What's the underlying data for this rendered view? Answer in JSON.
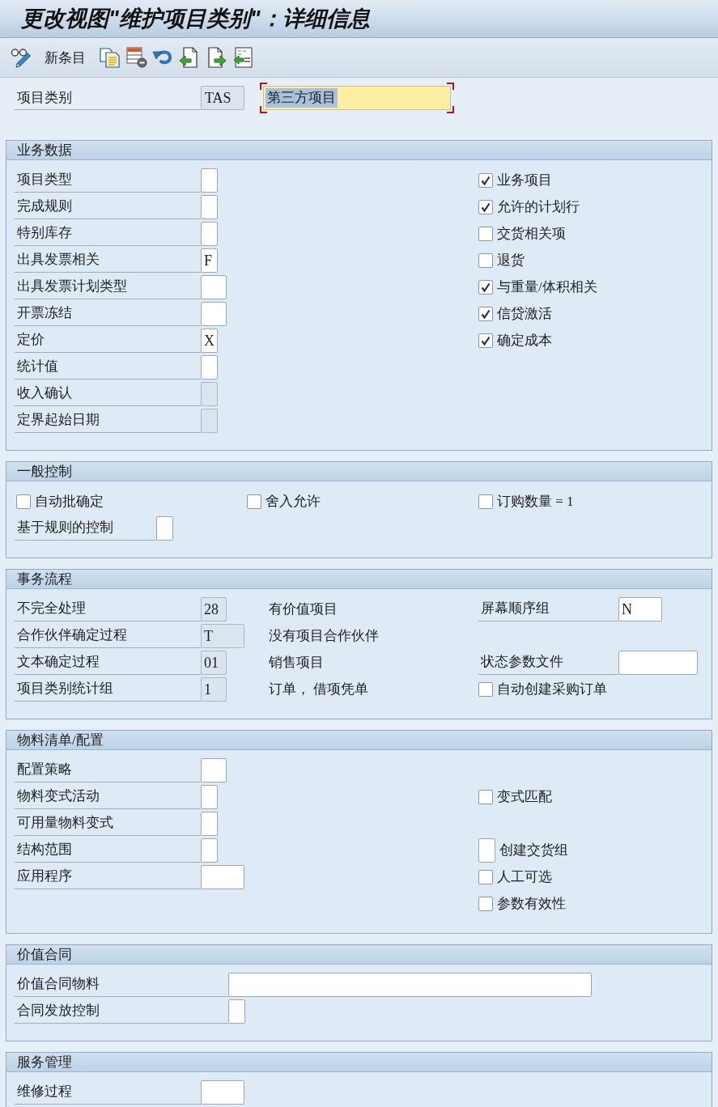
{
  "window": {
    "title": "更改视图\"维护项目类别\"：详细信息"
  },
  "toolbar": {
    "new_entries": "新条目"
  },
  "header": {
    "label": "项目类别",
    "code": {
      "value": "TAS",
      "editable": false
    },
    "description": {
      "value": "第三方项目",
      "focused": true
    }
  },
  "sections": [
    {
      "title": "业务数据",
      "rows": [
        {
          "left": {
            "kind": "field",
            "label": "项目类型",
            "editable": true
          },
          "right": {
            "kind": "checkbox",
            "label": "业务项目",
            "checked": true
          }
        },
        {
          "left": {
            "kind": "field",
            "label": "完成规则",
            "editable": true
          },
          "right": {
            "kind": "checkbox",
            "label": "允许的计划行",
            "checked": true
          }
        },
        {
          "left": {
            "kind": "field",
            "label": "特别库存",
            "editable": true
          },
          "right": {
            "kind": "checkbox",
            "label": "交货相关项",
            "checked": false
          }
        },
        {
          "left": {
            "kind": "field",
            "label": "出具发票相关",
            "value": "F",
            "editable": true
          },
          "right": {
            "kind": "checkbox",
            "label": "退货",
            "checked": false
          }
        },
        {
          "left": {
            "kind": "field",
            "label": "出具发票计划类型",
            "editable": true
          },
          "right": {
            "kind": "checkbox",
            "label": "与重量/体积相关",
            "checked": true
          }
        },
        {
          "left": {
            "kind": "field",
            "label": "开票冻结",
            "editable": true
          },
          "right": {
            "kind": "checkbox",
            "label": "信贷激活",
            "checked": true
          }
        },
        {
          "left": {
            "kind": "field",
            "label": "定价",
            "value": "X",
            "editable": true
          },
          "right": {
            "kind": "checkbox",
            "label": "确定成本",
            "checked": true
          }
        },
        {
          "left": {
            "kind": "field",
            "label": "统计值",
            "editable": true
          }
        },
        {
          "left": {
            "kind": "field",
            "label": "收入确认",
            "editable": false
          }
        },
        {
          "left": {
            "kind": "field",
            "label": "定界起始日期",
            "editable": false
          }
        }
      ]
    },
    {
      "title": "一般控制",
      "rows": [
        {
          "left": {
            "kind": "checkbox",
            "label": "自动批确定",
            "checked": false
          },
          "middle": {
            "kind": "checkbox",
            "label": "舍入允许",
            "checked": false
          },
          "right": {
            "kind": "checkbox",
            "label": "订购数量 = 1",
            "checked": false
          }
        },
        {
          "left": {
            "kind": "field",
            "label": "基于规则的控制",
            "editable": true
          }
        }
      ]
    },
    {
      "title": "事务流程",
      "rows": [
        {
          "left": {
            "kind": "field",
            "label": "不完全处理",
            "value": "28",
            "editable": false
          },
          "middle": {
            "kind": "text",
            "text": "有价值项目"
          },
          "right": {
            "kind": "field",
            "label": "屏幕顺序组",
            "value": "N",
            "editable": true
          }
        },
        {
          "left": {
            "kind": "field",
            "label": "合作伙伴确定过程",
            "value": "T",
            "editable": false
          },
          "middle": {
            "kind": "text",
            "text": "没有项目合作伙伴"
          }
        },
        {
          "left": {
            "kind": "field",
            "label": "文本确定过程",
            "value": "01",
            "editable": false
          },
          "middle": {
            "kind": "text",
            "text": "销售项目"
          },
          "right": {
            "kind": "field",
            "label": "状态参数文件",
            "editable": true
          }
        },
        {
          "left": {
            "kind": "field",
            "label": "项目类别统计组",
            "value": "1",
            "editable": false
          },
          "middle": {
            "kind": "text",
            "text": "订单， 借项凭单"
          },
          "right": {
            "kind": "checkbox",
            "label": "自动创建采购订单",
            "checked": false
          }
        }
      ]
    },
    {
      "title": "物料清单/配置",
      "rows": [
        {
          "left": {
            "kind": "field",
            "label": "配置策略",
            "editable": true
          }
        },
        {
          "left": {
            "kind": "field",
            "label": "物料变式活动",
            "editable": true
          },
          "right": {
            "kind": "checkbox",
            "label": "变式匹配",
            "checked": false
          }
        },
        {
          "left": {
            "kind": "field",
            "label": "可用量物料变式",
            "editable": true
          }
        },
        {
          "left": {
            "kind": "field",
            "label": "结构范围",
            "editable": true
          },
          "right": {
            "kind": "flagfield",
            "label": "创建交货组",
            "editable": true
          }
        },
        {
          "left": {
            "kind": "field",
            "label": "应用程序",
            "editable": true
          },
          "right": {
            "kind": "checkbox",
            "label": "人工可选",
            "checked": false
          }
        },
        {
          "right": {
            "kind": "checkbox",
            "label": "参数有效性",
            "checked": false
          }
        }
      ]
    },
    {
      "title": "价值合同",
      "rows": [
        {
          "left": {
            "kind": "field",
            "label": "价值合同物料",
            "editable": true
          }
        },
        {
          "left": {
            "kind": "field",
            "label": "合同发放控制",
            "editable": true
          }
        }
      ]
    },
    {
      "title": "服务管理",
      "rows": [
        {
          "left": {
            "kind": "field",
            "label": "维修过程",
            "editable": true
          }
        }
      ]
    }
  ]
}
